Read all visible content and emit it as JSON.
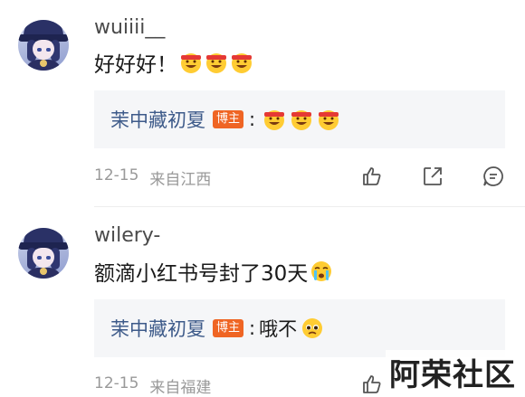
{
  "comments": [
    {
      "username": "wuiiii__",
      "content": "好好好！",
      "content_emojis": [
        "grinning-face-headband-emoji",
        "grinning-face-headband-emoji",
        "grinning-face-headband-emoji"
      ],
      "reply": {
        "author": "茉中藏初夏",
        "badge": "博主",
        "separator": ":",
        "text": "",
        "emojis": [
          "grinning-face-headband-emoji",
          "grinning-face-headband-emoji",
          "grinning-face-headband-emoji"
        ]
      },
      "date": "12-15",
      "location": "来自江西"
    },
    {
      "username": "wilery-",
      "content": "额滴小红书号封了30天",
      "content_emojis": [
        "crying-face-emoji"
      ],
      "reply": {
        "author": "茉中藏初夏",
        "badge": "博主",
        "separator": ":",
        "text": "哦不",
        "emojis": [
          "pleading-face-emoji"
        ]
      },
      "date": "12-15",
      "location": "来自福建"
    }
  ],
  "actions": [
    "like-icon",
    "share-icon",
    "comment-icon"
  ],
  "watermark": "阿荣社区",
  "colors": {
    "reply_name": "#3e5b8a",
    "badge": "#ef6524",
    "reply_bg": "#f5f6f8",
    "meta": "#999999"
  }
}
